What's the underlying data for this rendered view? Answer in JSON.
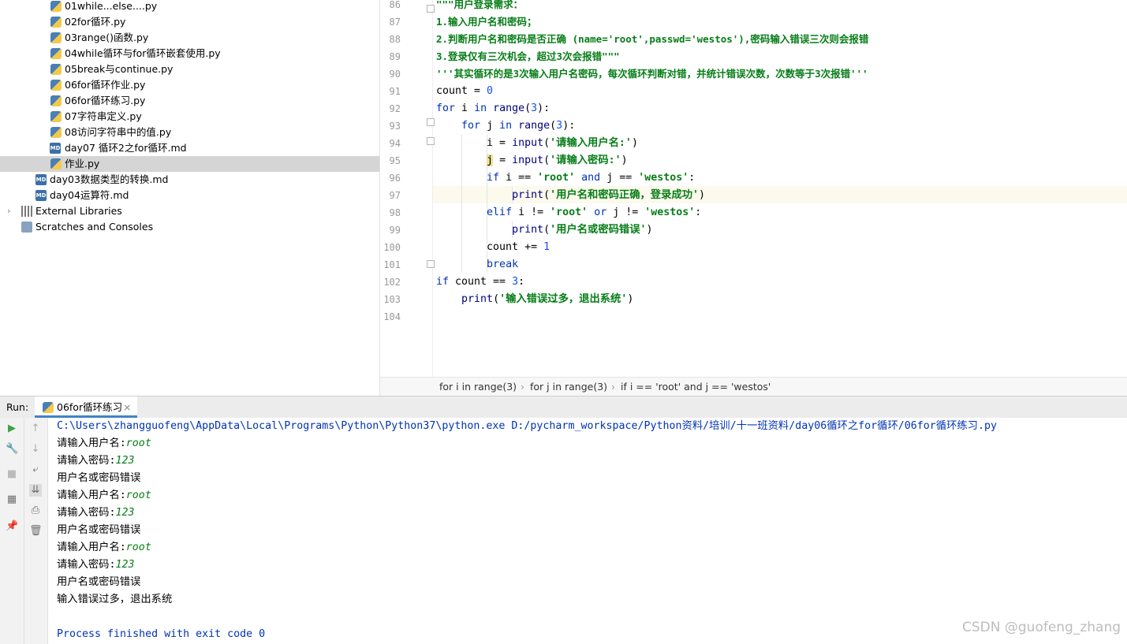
{
  "project_tree": {
    "items": [
      {
        "label": "01while...else....py",
        "icon": "python-file-icon"
      },
      {
        "label": "02for循环.py",
        "icon": "python-file-icon"
      },
      {
        "label": "03range()函数.py",
        "icon": "python-file-icon"
      },
      {
        "label": "04while循环与for循环嵌套使用.py",
        "icon": "python-file-icon"
      },
      {
        "label": "05break与continue.py",
        "icon": "python-file-icon"
      },
      {
        "label": "06for循环作业.py",
        "icon": "python-file-icon"
      },
      {
        "label": "06for循环练习.py",
        "icon": "python-file-icon"
      },
      {
        "label": "07字符串定义.py",
        "icon": "python-file-icon"
      },
      {
        "label": "08访问字符串中的值.py",
        "icon": "python-file-icon"
      },
      {
        "label": "day07 循环2之for循环.md",
        "icon": "markdown-file-icon"
      },
      {
        "label": "作业.py",
        "icon": "python-file-icon"
      },
      {
        "label": "day03数据类型的转换.md",
        "icon": "markdown-file-icon"
      },
      {
        "label": "day04运算符.md",
        "icon": "markdown-file-icon"
      },
      {
        "label": "External Libraries",
        "icon": "library-icon"
      },
      {
        "label": "Scratches and Consoles",
        "icon": "scratches-icon"
      }
    ],
    "md_badge": "MD"
  },
  "editor": {
    "line_numbers": [
      "86",
      "87",
      "88",
      "89",
      "90",
      "91",
      "92",
      "93",
      "94",
      "95",
      "96",
      "97",
      "98",
      "99",
      "100",
      "101",
      "102",
      "103",
      "104"
    ],
    "lines": [
      "\"\"\"用户登录需求：",
      "1.输入用户名和密码；",
      "2.判断用户名和密码是否正确 (name='root',passwd='westos'),密码输入错误三次则会报错",
      "3.登录仅有三次机会，超过3次会报错\"\"\"",
      "'''其实循环的是3次输入用户名密码，每次循环判断对错，并统计错误次数，次数等于3次报错'''",
      "count = 0",
      "for i in range(3):",
      "    for j in range(3):",
      "        i = input('请输入用户名:')",
      "        j = input('请输入密码:')",
      "        if i == 'root' and j == 'westos':",
      "            print('用户名和密码正确，登录成功')",
      "        elif i != 'root' or j != 'westos':",
      "            print('用户名或密码错误')",
      "        count += 1",
      "        break",
      "if count == 3:",
      "    print('输入错误过多，退出系统')",
      ""
    ]
  },
  "breadcrumbs": [
    "for i in range(3)",
    "for j in range(3)",
    "if i == 'root' and j == 'westos'"
  ],
  "run_panel": {
    "label": "Run:",
    "tab": "06for循环练习",
    "close": "×",
    "command": "C:\\Users\\zhangguofeng\\AppData\\Local\\Programs\\Python\\Python37\\python.exe D:/pycharm_workspace/Python资料/培训/十一班资料/day06循环之for循环/06for循环练习.py",
    "output": [
      {
        "prompt": "请输入用户名:",
        "input": "root"
      },
      {
        "prompt": "请输入密码:",
        "input": "123"
      },
      {
        "prompt": "用户名或密码错误",
        "input": ""
      },
      {
        "prompt": "请输入用户名:",
        "input": "root"
      },
      {
        "prompt": "请输入密码:",
        "input": "123"
      },
      {
        "prompt": "用户名或密码错误",
        "input": ""
      },
      {
        "prompt": "请输入用户名:",
        "input": "root"
      },
      {
        "prompt": "请输入密码:",
        "input": "123"
      },
      {
        "prompt": "用户名或密码错误",
        "input": ""
      },
      {
        "prompt": "输入错误过多，退出系统",
        "input": ""
      },
      {
        "prompt": "",
        "input": ""
      },
      {
        "prompt": "Process finished with exit code 0",
        "input": ""
      }
    ]
  },
  "watermark": "CSDN @guofeng_zhang",
  "colors": {
    "keyword": "#0033b3",
    "string": "#067d17",
    "number": "#1750eb",
    "selection": "#d5d5d5",
    "current_line": "#fcfaed"
  }
}
